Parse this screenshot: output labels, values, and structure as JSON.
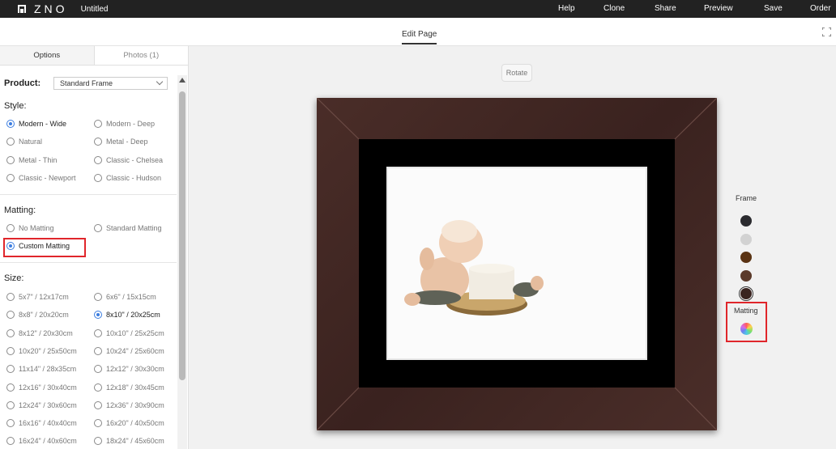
{
  "app": {
    "logo_text": "ZNO",
    "doc_title": "Untitled"
  },
  "top_menu": [
    "Help",
    "Clone",
    "Share",
    "Preview",
    "Save",
    "Order"
  ],
  "subbar": {
    "tab_label": "Edit Page"
  },
  "panel": {
    "tabs": [
      {
        "label": "Options",
        "active": true
      },
      {
        "label": "Photos (1)",
        "active": false
      }
    ],
    "product_label": "Product:",
    "product_value": "Standard Frame",
    "style_label": "Style:",
    "styles": [
      {
        "label": "Modern - Wide",
        "checked": true
      },
      {
        "label": "Modern - Deep",
        "checked": false
      },
      {
        "label": "Natural",
        "checked": false
      },
      {
        "label": "Metal - Deep",
        "checked": false
      },
      {
        "label": "Metal - Thin",
        "checked": false
      },
      {
        "label": "Classic - Chelsea",
        "checked": false
      },
      {
        "label": "Classic - Newport",
        "checked": false
      },
      {
        "label": "Classic - Hudson",
        "checked": false
      }
    ],
    "matting_label": "Matting:",
    "matting": [
      {
        "label": "No Matting",
        "checked": false
      },
      {
        "label": "Standard Matting",
        "checked": false
      },
      {
        "label": "Custom Matting",
        "checked": true
      }
    ],
    "size_label": "Size:",
    "sizes": [
      {
        "label": "5x7\" / 12x17cm",
        "checked": false
      },
      {
        "label": "6x6\" / 15x15cm",
        "checked": false
      },
      {
        "label": "8x8\" / 20x20cm",
        "checked": false
      },
      {
        "label": "8x10\" / 20x25cm",
        "checked": true
      },
      {
        "label": "8x12\" / 20x30cm",
        "checked": false
      },
      {
        "label": "10x10\" / 25x25cm",
        "checked": false
      },
      {
        "label": "10x20\" / 25x50cm",
        "checked": false
      },
      {
        "label": "10x24\" / 25x60cm",
        "checked": false
      },
      {
        "label": "11x14\" / 28x35cm",
        "checked": false
      },
      {
        "label": "12x12\" / 30x30cm",
        "checked": false
      },
      {
        "label": "12x16\" / 30x40cm",
        "checked": false
      },
      {
        "label": "12x18\" / 30x45cm",
        "checked": false
      },
      {
        "label": "12x24\" / 30x60cm",
        "checked": false
      },
      {
        "label": "12x36\" / 30x90cm",
        "checked": false
      },
      {
        "label": "16x16\" / 40x40cm",
        "checked": false
      },
      {
        "label": "16x20\" / 40x50cm",
        "checked": false
      },
      {
        "label": "16x24\" / 40x60cm",
        "checked": false
      },
      {
        "label": "18x24\" / 45x60cm",
        "checked": false
      }
    ]
  },
  "canvas": {
    "rotate_label": "Rotate"
  },
  "swatches": {
    "frame_label": "Frame",
    "frame_colors": [
      "#2b2b2f",
      "#d2d2d2",
      "#5a3313",
      "#5b3a2a",
      "#3a2420"
    ],
    "matting_label": "Matting"
  }
}
